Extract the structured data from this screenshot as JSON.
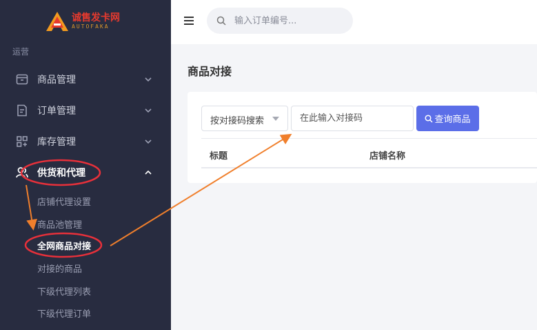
{
  "brand": {
    "title": "诚售发卡网",
    "subtitle": "AUTOFAKA"
  },
  "sidebar": {
    "section_title": "运营",
    "items": [
      {
        "label": "商品管理",
        "icon": "box-icon"
      },
      {
        "label": "订单管理",
        "icon": "order-icon"
      },
      {
        "label": "库存管理",
        "icon": "grid-icon"
      },
      {
        "label": "供货和代理",
        "icon": "user-icon"
      }
    ],
    "sub_items": [
      {
        "label": "店铺代理设置"
      },
      {
        "label": "商品池管理"
      },
      {
        "label": "全网商品对接"
      },
      {
        "label": "对接的商品"
      },
      {
        "label": "下级代理列表"
      },
      {
        "label": "下级代理订单"
      }
    ]
  },
  "topbar": {
    "search_placeholder": "输入订单编号..."
  },
  "main": {
    "page_title": "商品对接",
    "search_type": "按对接码搜索",
    "code_placeholder": "在此输入对接码",
    "query_button": "查询商品",
    "columns": [
      "标题",
      "店铺名称"
    ]
  },
  "colors": {
    "sidebar_bg": "#282c40",
    "accent": "#5b6ee8",
    "annotation_red": "#e8303a",
    "annotation_orange": "#f07f2c"
  }
}
